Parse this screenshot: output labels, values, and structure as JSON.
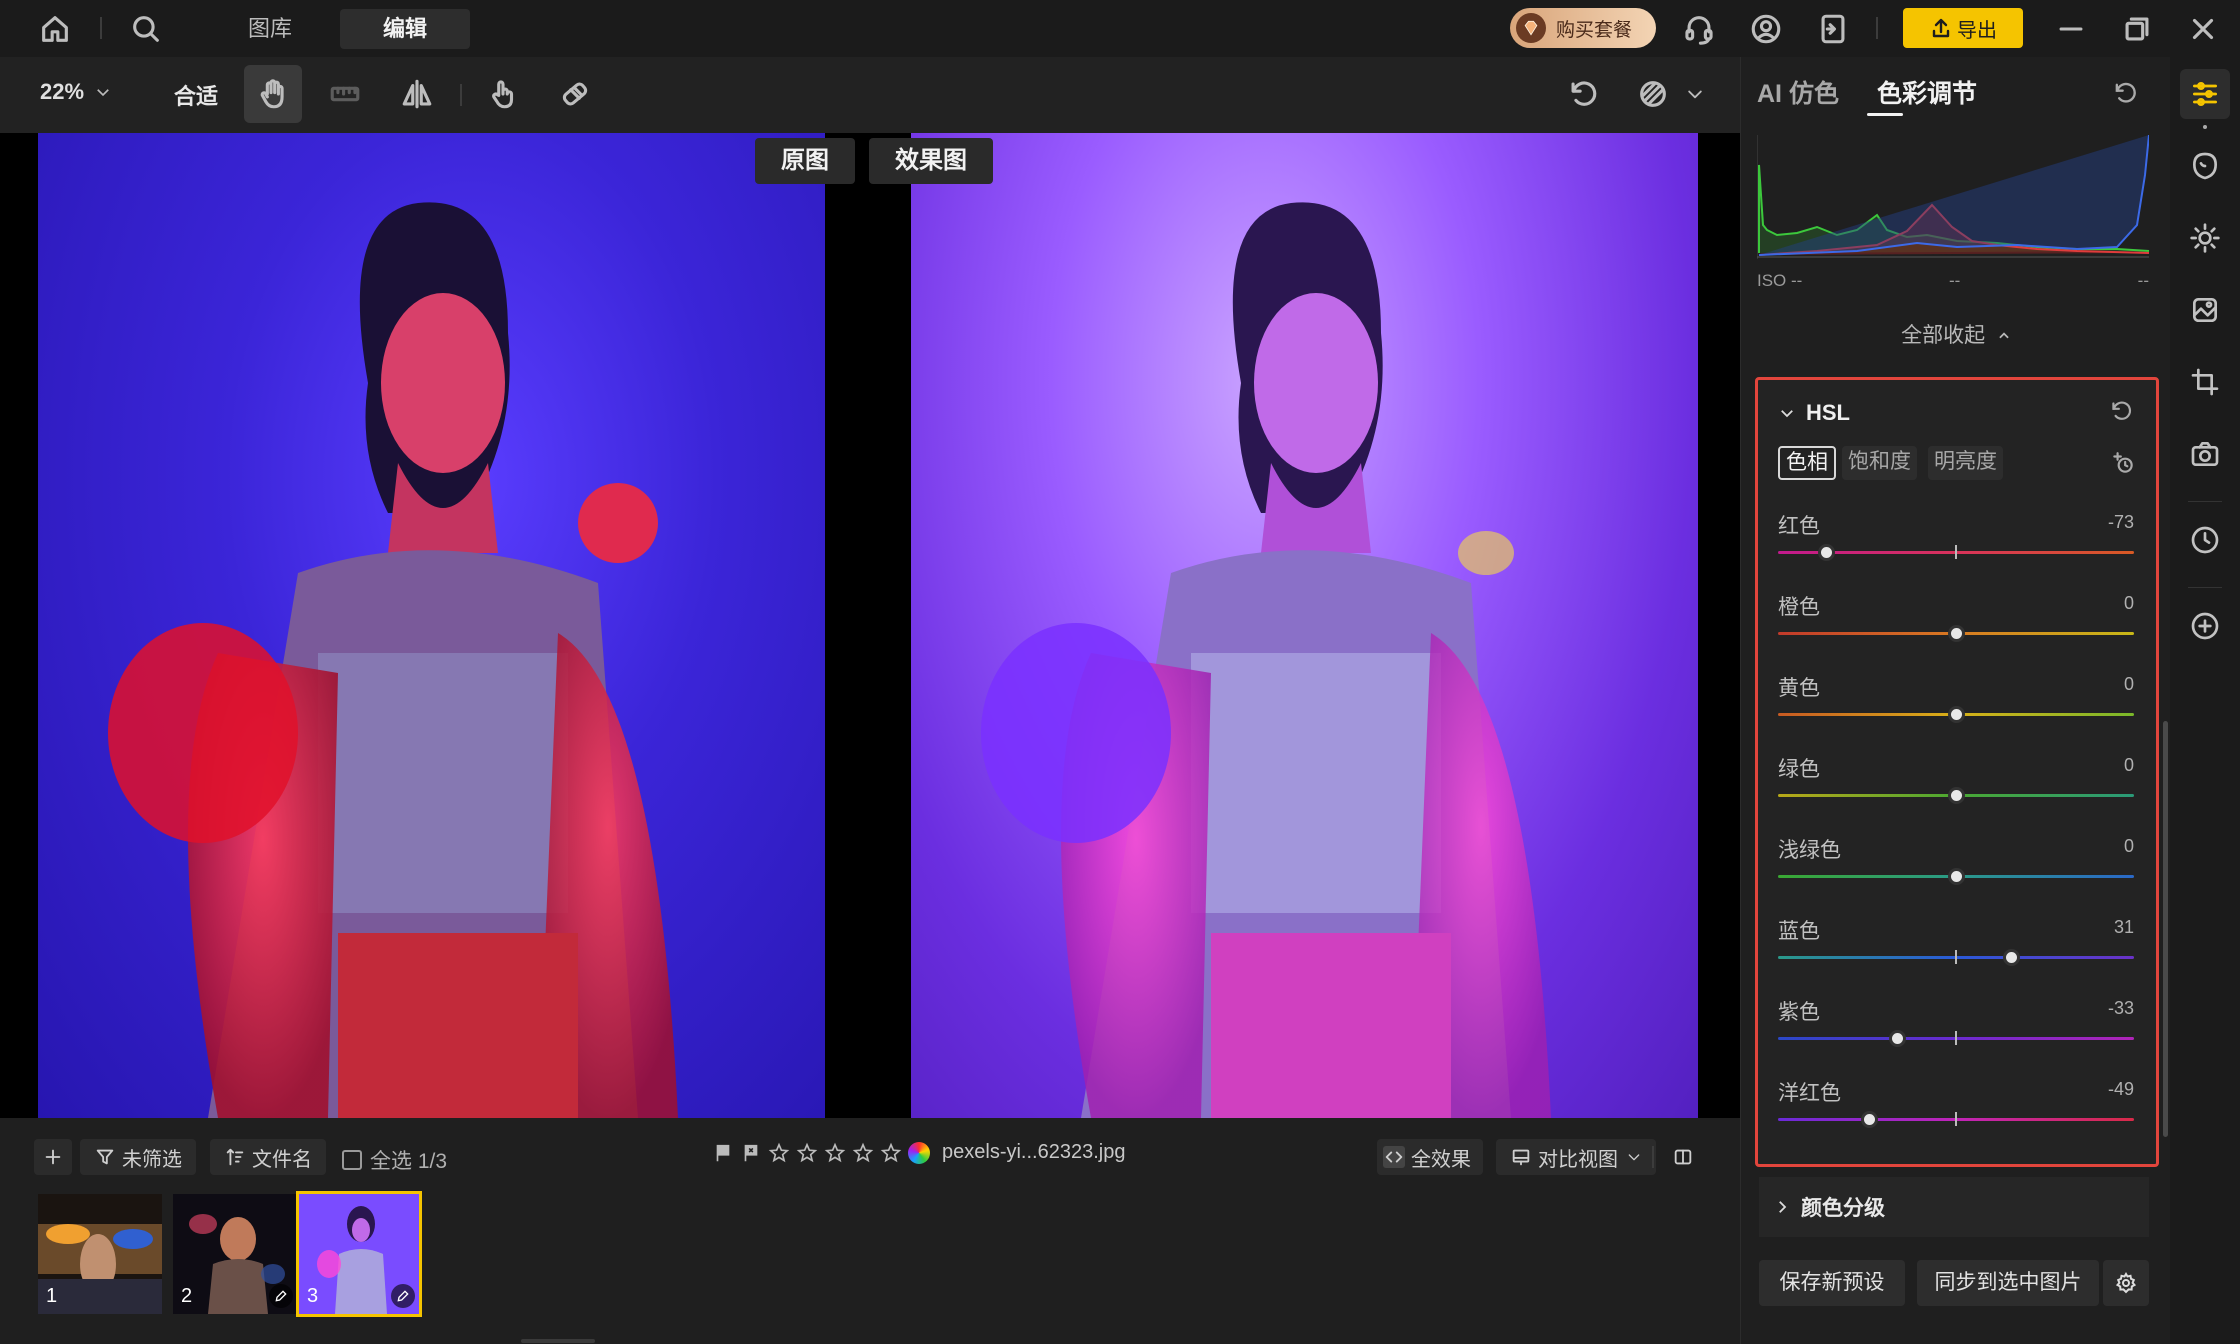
{
  "topbar": {
    "nav_library": "图库",
    "nav_edit": "编辑",
    "buy_label": "购买套餐",
    "export_label": "导出",
    "export_color": "#f5c400",
    "icons": [
      "home-icon",
      "search-icon",
      "headset-icon",
      "user-icon",
      "switch-icon",
      "minimize-icon",
      "restore-icon",
      "close-icon"
    ]
  },
  "toolbar": {
    "zoom": "22%",
    "fit": "合适",
    "tools": [
      "hand-icon",
      "ruler-icon",
      "flip-icon",
      "touch-icon",
      "eraser-icon"
    ],
    "right_icons": [
      "undo-icon",
      "mask-overlay-icon",
      "chevron-down-icon"
    ]
  },
  "canvas": {
    "label_original": "原图",
    "label_effect": "效果图"
  },
  "filmbar": {
    "unfiltered": "未筛选",
    "sort_name": "文件名",
    "select_all": "全选 1/3",
    "filename": "pexels-yi...62323.jpg",
    "full_effect": "全效果",
    "compare_view": "对比视图"
  },
  "thumbnails": [
    {
      "num": "1",
      "edited": false
    },
    {
      "num": "2",
      "edited": true
    },
    {
      "num": "3",
      "edited": true,
      "selected": true
    }
  ],
  "panel": {
    "tab_ai": "AI 仿色",
    "tab_color": "色彩调节",
    "iso_label": "ISO --",
    "iso_mid": "--",
    "iso_right": "--",
    "collapse_all": "全部收起",
    "hsl_title": "HSL",
    "hsl_subtabs": [
      "色相",
      "饱和度",
      "明亮度"
    ],
    "sliders": [
      {
        "label": "红色",
        "value": "-73",
        "num": -73
      },
      {
        "label": "橙色",
        "value": "0",
        "num": 0
      },
      {
        "label": "黄色",
        "value": "0",
        "num": 0
      },
      {
        "label": "绿色",
        "value": "0",
        "num": 0
      },
      {
        "label": "浅绿色",
        "value": "0",
        "num": 0
      },
      {
        "label": "蓝色",
        "value": "31",
        "num": 31
      },
      {
        "label": "紫色",
        "value": "-33",
        "num": -33
      },
      {
        "label": "洋红色",
        "value": "-49",
        "num": -49
      }
    ],
    "grading_title": "颜色分级",
    "save_preset": "保存新预设",
    "sync_selected": "同步到选中图片",
    "highlight_color": "#e2453c"
  }
}
